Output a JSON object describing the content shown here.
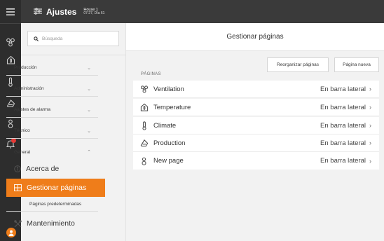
{
  "header": {
    "title": "Ajustes",
    "house_name": "House 1",
    "house_time": "07:27, Día 61"
  },
  "search": {
    "placeholder": "Búsqueda"
  },
  "nav": {
    "groups": [
      {
        "label": "Producción",
        "expanded": false
      },
      {
        "label": "Administración",
        "expanded": false
      },
      {
        "label": "Ajustes de alarma",
        "expanded": false
      },
      {
        "label": "Técnico",
        "expanded": false
      },
      {
        "label": "General",
        "expanded": true
      }
    ],
    "general_items": {
      "about": "Acerca de",
      "manage_pages": "Gestionar páginas",
      "default_pages": "Páginas predeterminadas",
      "maintenance": "Mantenimiento"
    }
  },
  "main": {
    "title": "Gestionar páginas",
    "reorganize_button": "Reorganizar páginas",
    "new_page_button": "Página nueva",
    "section_label": "PÁGINAS",
    "pages": [
      {
        "name": "Ventilation",
        "icon": "fan-icon",
        "location": "En barra lateral"
      },
      {
        "name": "Temperature",
        "icon": "house-thermometer-icon",
        "location": "En barra lateral"
      },
      {
        "name": "Climate",
        "icon": "thermometer-icon",
        "location": "En barra lateral"
      },
      {
        "name": "Production",
        "icon": "production-icon",
        "location": "En barra lateral"
      },
      {
        "name": "New page",
        "icon": "person-icon",
        "location": "En barra lateral"
      }
    ]
  },
  "colors": {
    "accent": "#ef7d1a",
    "topbar": "#3a3a3a",
    "rail": "#2d2d2d",
    "badge": "#e53935"
  }
}
